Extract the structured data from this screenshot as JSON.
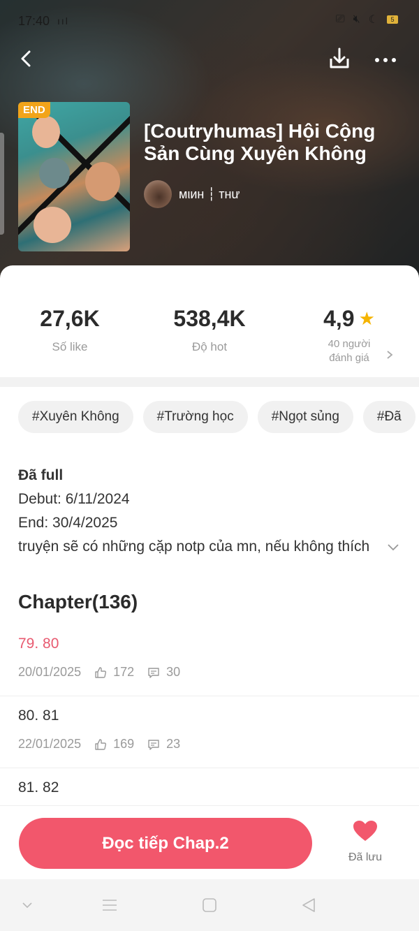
{
  "status_bar": {
    "time": "17:40",
    "signal": "ııl",
    "battery": "5"
  },
  "comic": {
    "badge": "END",
    "title": "[Coutryhumas] Hội Cộng Sản Cùng Xuyên Không",
    "author": "мιин ┆ тнư"
  },
  "stats": {
    "likes": {
      "value": "27,6K",
      "label": "Số like"
    },
    "hot": {
      "value": "538,4K",
      "label": "Độ hot"
    },
    "rating": {
      "value": "4,9",
      "label_line1": "40 người",
      "label_line2": "đánh giá"
    }
  },
  "tags": [
    "#Xuyên Không",
    "#Trường học",
    "#Ngọt sủng",
    "#Đã"
  ],
  "description": {
    "status": "Đã full",
    "debut": "Debut: 6/11/2024",
    "end": "End: 30/4/2025",
    "summary": "truyện sẽ có những cặp notp của mn, nếu không thích"
  },
  "chapters": {
    "heading": "Chapter(136)",
    "items": [
      {
        "title": "79. 80",
        "date": "20/01/2025",
        "likes": "172",
        "comments": "30",
        "active": true
      },
      {
        "title": "80. 81",
        "date": "22/01/2025",
        "likes": "169",
        "comments": "23",
        "active": false
      },
      {
        "title": "81. 82",
        "date": "",
        "likes": "",
        "comments": "",
        "active": false
      }
    ]
  },
  "actions": {
    "read_label": "Đọc tiếp Chap.2",
    "save_label": "Đã lưu"
  },
  "colors": {
    "accent": "#f2576c",
    "star": "#f5b400",
    "badge": "#f2a41a"
  }
}
